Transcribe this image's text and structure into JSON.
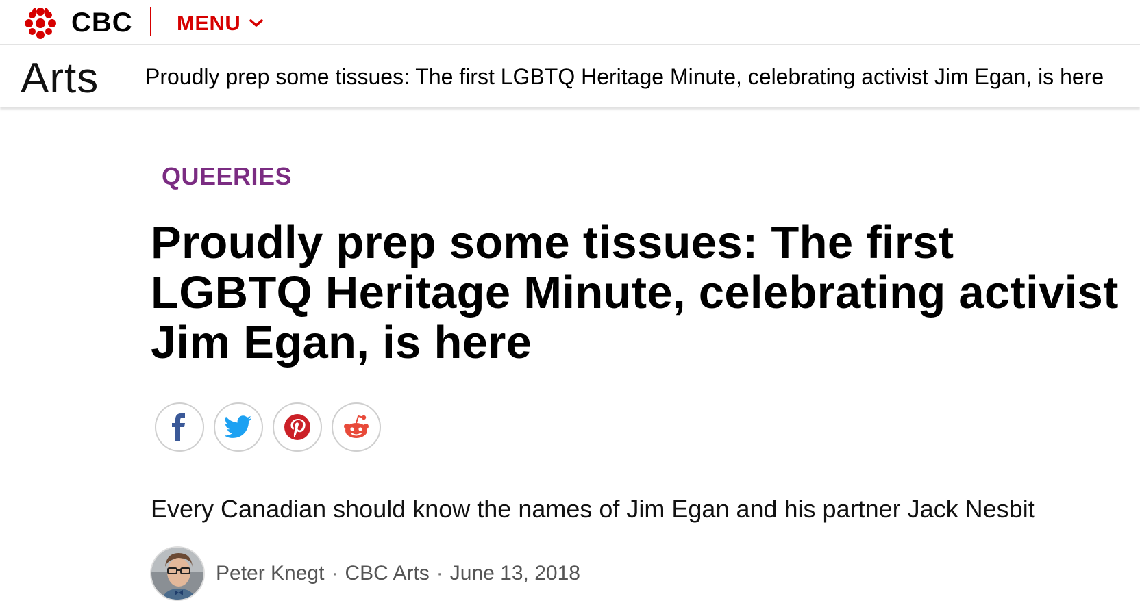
{
  "topbar": {
    "brand": "CBC",
    "menu_label": "MENU",
    "accent_color": "#d60000"
  },
  "section": {
    "name": "Arts",
    "headline": "Proudly prep some tissues: The first LGBTQ Heritage Minute, celebrating activist Jim Egan, is here"
  },
  "article": {
    "category": "QUEERIES",
    "category_color": "#7b2c82",
    "headline": "Proudly prep some tissues: The first LGBTQ Heritage Minute, celebrating activist Jim Egan, is here",
    "deck": "Every Canadian should know the names of Jim Egan and his partner Jack Nesbit",
    "share": [
      {
        "icon": "facebook-icon",
        "color": "#3b5998"
      },
      {
        "icon": "twitter-icon",
        "color": "#1da1f2"
      },
      {
        "icon": "pinterest-icon",
        "color": "#cb2027"
      },
      {
        "icon": "reddit-icon",
        "color": "#e84a3a"
      }
    ],
    "byline": {
      "author": "Peter Knegt",
      "separator": "·",
      "source": "CBC Arts",
      "date": "June 13, 2018"
    }
  }
}
